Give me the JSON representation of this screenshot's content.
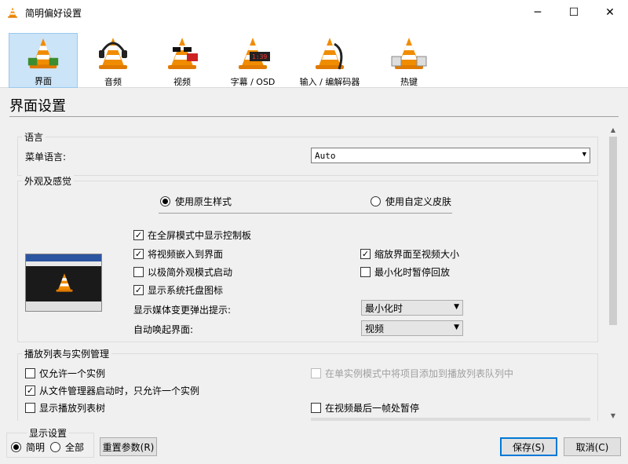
{
  "window": {
    "title": "简明偏好设置",
    "min_symbol": "─",
    "max_symbol": "☐",
    "close_symbol": "✕"
  },
  "categories": [
    {
      "label": "界面",
      "icon": "vlc-cone-interface-icon",
      "selected": true
    },
    {
      "label": "音频",
      "icon": "vlc-cone-headphones-icon",
      "selected": false
    },
    {
      "label": "视频",
      "icon": "vlc-cone-glasses-icon",
      "selected": false
    },
    {
      "label": "字幕 / OSD",
      "icon": "vlc-cone-subtitle-icon",
      "selected": false
    },
    {
      "label": "输入 / 编解码器",
      "icon": "vlc-cone-cable-icon",
      "selected": false
    },
    {
      "label": "热键",
      "icon": "vlc-cone-hotkeys-icon",
      "selected": false
    }
  ],
  "page_title": "界面设置",
  "language": {
    "legend": "语言",
    "menu_lang_label": "菜单语言:",
    "menu_lang_value": "Auto"
  },
  "look": {
    "legend": "外观及感觉",
    "native_style": "使用原生样式",
    "custom_skin": "使用自定义皮肤",
    "fullscreen_controls": "在全屏模式中显示控制板",
    "embed_video": "将视频嵌入到界面",
    "minimal_start": "以极简外观模式启动",
    "systray_icon": "显示系统托盘图标",
    "resize_to_video": "缩放界面至视频大小",
    "pause_minimized": "最小化时暂停回放",
    "popup_label": "显示媒体变更弹出提示:",
    "popup_value": "最小化时",
    "raise_label": "自动唤起界面:",
    "raise_value": "视频"
  },
  "playlist": {
    "legend": "播放列表与实例管理",
    "one_instance": "仅允许一个实例",
    "one_instance_fm": "从文件管理器启动时，只允许一个实例",
    "show_tree": "显示播放列表树",
    "enqueue_single": "在单实例模式中将项目添加到播放列表队列中",
    "pause_last_frame": "在视频最后一帧处暂停"
  },
  "display": {
    "legend": "显示设置",
    "simple": "简明",
    "all": "全部"
  },
  "buttons": {
    "reset": "重置参数(R)",
    "save": "保存(S)",
    "cancel": "取消(C)"
  },
  "check_mark": "✓",
  "colors": {
    "cone_orange": "#f08c00",
    "selection": "#cce4f7",
    "accent": "#0078d7"
  }
}
